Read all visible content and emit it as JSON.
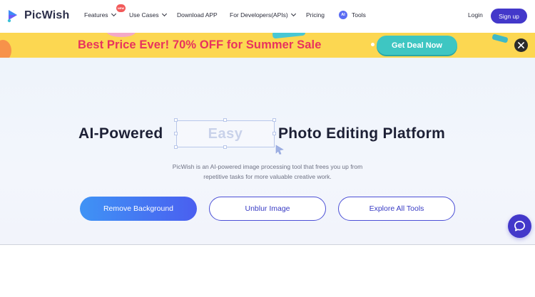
{
  "nav": {
    "brand": "PicWish",
    "items": [
      {
        "label": "Features",
        "has_dropdown": true
      },
      {
        "label": "Use Cases",
        "has_dropdown": true
      },
      {
        "label": "Download APP",
        "has_dropdown": false
      },
      {
        "label": "For Developers(APIs)",
        "has_dropdown": true
      },
      {
        "label": "Pricing",
        "has_dropdown": false
      },
      {
        "label": "Tools",
        "has_dropdown": false
      }
    ],
    "new_badge": "NEW",
    "ai_badge": "AI",
    "login": "Login",
    "signup": "Sign up"
  },
  "banner": {
    "promo_text": "Best Price Ever! 70% OFF for Summer Sale",
    "cta": "Get Deal Now"
  },
  "hero": {
    "title_left": "AI-Powered",
    "title_highlight": "Easy",
    "title_right": "Photo Editing Platform",
    "subtitle_line1": "PicWish is an AI-powered image processing tool that frees you up from",
    "subtitle_line2": "repetitive tasks for more valuable creative work.",
    "buttons": {
      "remove_background": "Remove Background",
      "unblur_image": "Unblur Image",
      "explore_all_tools": "Explore All Tools"
    }
  },
  "colors": {
    "brand": "#4338ca",
    "banner_bg": "#fcd751",
    "promo_text": "#e8325e",
    "deal_button": "#3ec6c2"
  },
  "icons": [
    "picwish-logo-icon",
    "chevron-down-icon",
    "close-icon",
    "cursor-icon",
    "chat-icon"
  ]
}
